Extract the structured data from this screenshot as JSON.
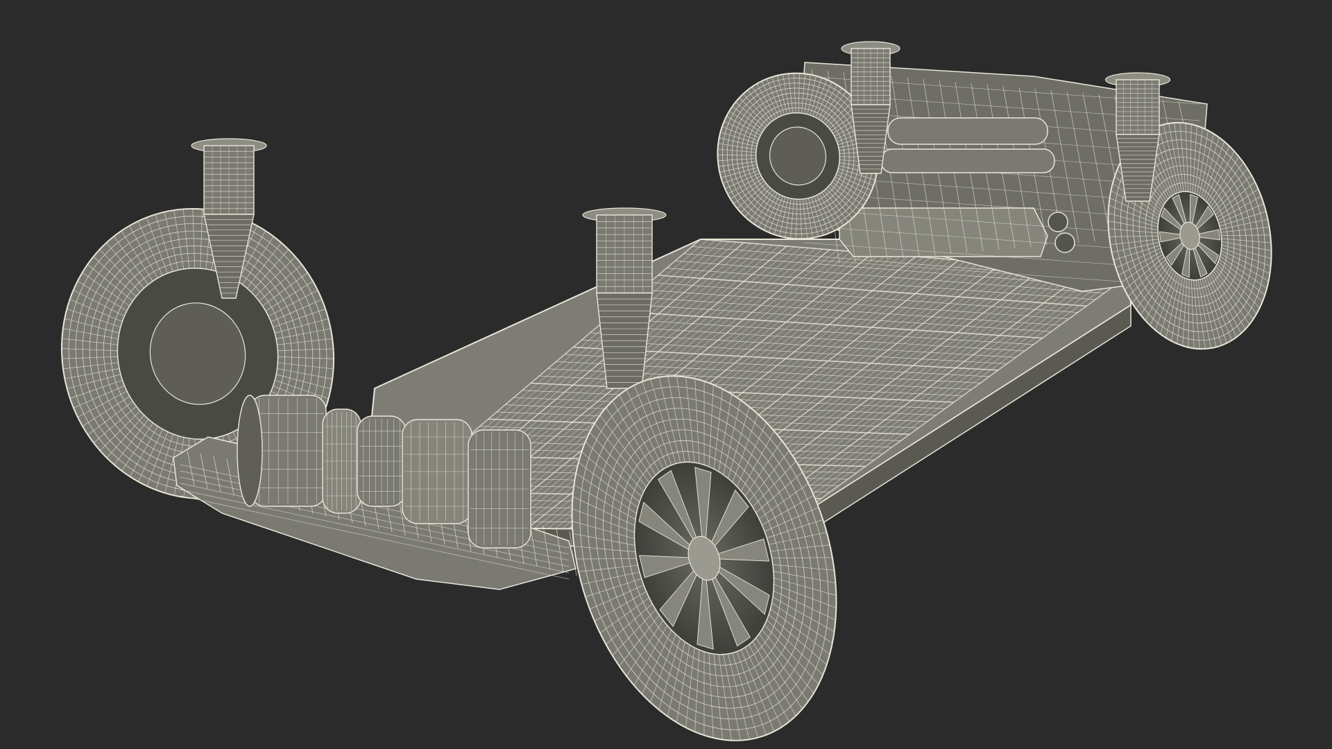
{
  "scene": {
    "background_color": "#2b2b2b",
    "mesh_fill_color": "#7a7a72",
    "mesh_shadow_color": "#4a4a44",
    "wire_color": "#e9e6d8"
  }
}
